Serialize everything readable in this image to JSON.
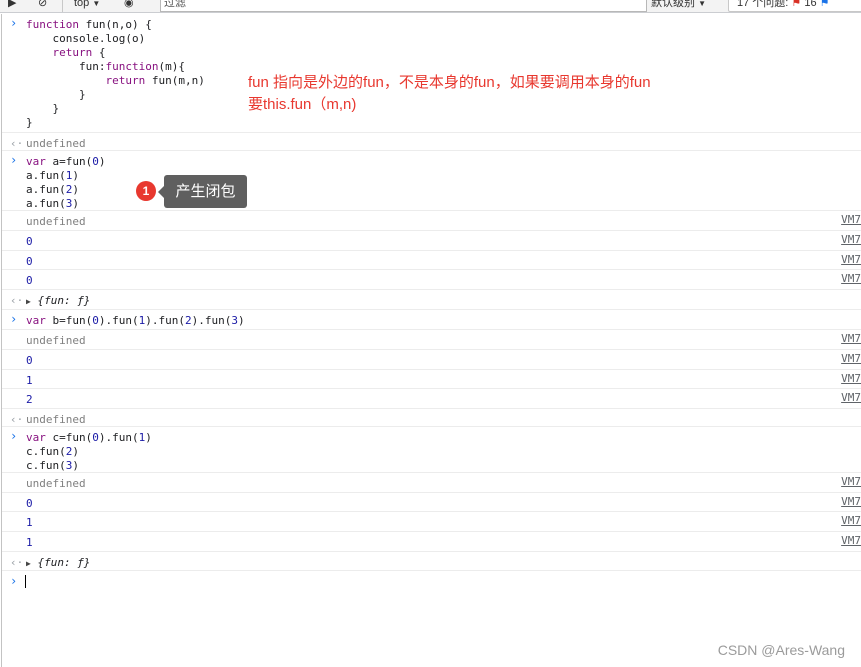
{
  "toolbar": {
    "context": "top",
    "filter_placeholder": "过滤",
    "levels": "默认级别",
    "issues": "17 个问题:",
    "issues_count": "16",
    "icons": [
      "play-panel-icon",
      "block-icon",
      "eye-icon",
      "chevron-down-icon",
      "error-flag-icon",
      "info-flag-icon"
    ]
  },
  "console": {
    "entries": [
      {
        "kind": "input",
        "text": "function fun(n,o) {\n    console.log(o)\n    return {\n        fun:function(m){\n            return fun(m,n)\n        }\n    }\n}",
        "h": 120
      },
      {
        "kind": "result",
        "text": "undefined",
        "h": 19
      },
      {
        "kind": "input",
        "text": "var a=fun(0)\na.fun(1)\na.fun(2)\na.fun(3)",
        "h": 61
      },
      {
        "kind": "log",
        "text": "undefined",
        "source": "VM7",
        "h": 21
      },
      {
        "kind": "log",
        "text": "0",
        "source": "VM7",
        "h": 21
      },
      {
        "kind": "log",
        "text": "0",
        "source": "VM7",
        "h": 20
      },
      {
        "kind": "log",
        "text": "0",
        "source": "VM7",
        "h": 21
      },
      {
        "kind": "object",
        "text": "{fun: ƒ}",
        "h": 21
      },
      {
        "kind": "input",
        "text": "var b=fun(0).fun(1).fun(2).fun(3)",
        "h": 21
      },
      {
        "kind": "log",
        "text": "undefined",
        "source": "VM7",
        "h": 21
      },
      {
        "kind": "log",
        "text": "0",
        "source": "VM7",
        "h": 21
      },
      {
        "kind": "log",
        "text": "1",
        "source": "VM7",
        "h": 20
      },
      {
        "kind": "log",
        "text": "2",
        "source": "VM7",
        "h": 21
      },
      {
        "kind": "result",
        "text": "undefined",
        "h": 19
      },
      {
        "kind": "input",
        "text": "var c=fun(0).fun(1)\nc.fun(2)\nc.fun(3)",
        "h": 47
      },
      {
        "kind": "log",
        "text": "undefined",
        "source": "VM7",
        "h": 21
      },
      {
        "kind": "log",
        "text": "0",
        "source": "VM7",
        "h": 20
      },
      {
        "kind": "log",
        "text": "1",
        "source": "VM7",
        "h": 21
      },
      {
        "kind": "log",
        "text": "1",
        "source": "VM7",
        "h": 21
      },
      {
        "kind": "object",
        "text": "{fun: ƒ}",
        "h": 20
      }
    ],
    "prompt_h": 24
  },
  "annotation": {
    "line1": "fun 指向是外边的fun，不是本身的fun，如果要调用本身的fun",
    "line2": "要this.fun（m,n)"
  },
  "marker": {
    "number": "1",
    "label": "产生闭包"
  },
  "watermark": "CSDN @Ares-Wang",
  "colors": {
    "annotation": "#e8382f",
    "marker": "#e8382f",
    "tooltip": "#5f5f5f",
    "prompt": "#1a73e8",
    "keyword": "#881280",
    "number": "#1a1aa6"
  }
}
